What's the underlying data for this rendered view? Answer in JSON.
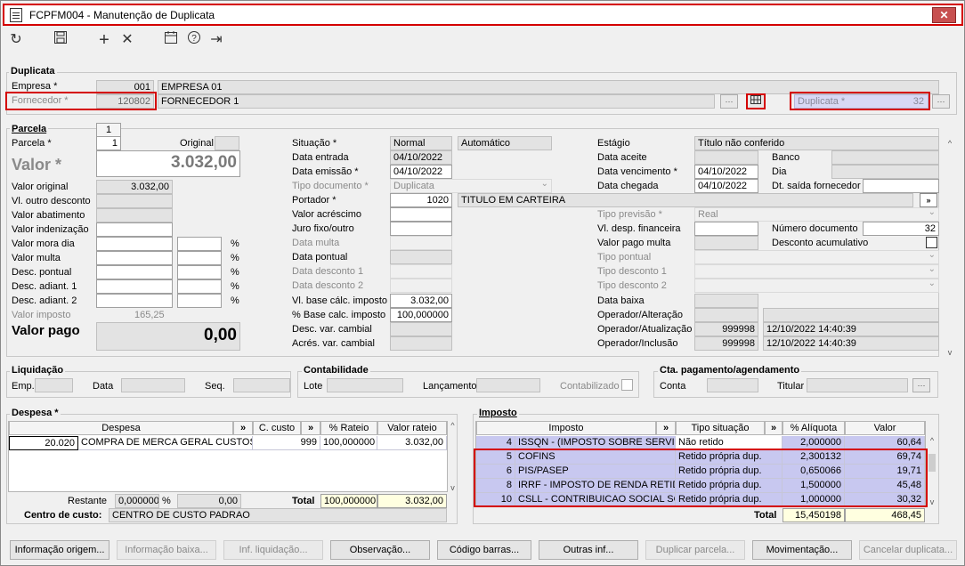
{
  "window": {
    "title": "FCPFM004 - Manutenção de Duplicata",
    "close": "✕"
  },
  "toolbar": {
    "refresh": "↻",
    "save": "💾",
    "add": "+",
    "delete": "✕",
    "calendar": "📅",
    "help": "?",
    "exit": "⇥"
  },
  "duplicata": {
    "group_title": "Duplicata",
    "empresa_label": "Empresa *",
    "empresa_code": "001",
    "empresa_name": "EMPRESA 01",
    "fornecedor_label": "Fornecedor *",
    "fornecedor_code": "120802",
    "fornecedor_name": "FORNECEDOR 1",
    "duplicata_label": "Duplicata *",
    "duplicata_value": "32"
  },
  "parcela": {
    "group_title": "Parcela",
    "tab": "1",
    "parcela_label": "Parcela *",
    "parcela_value": "1",
    "original_label": "Original",
    "valor_label": "Valor *",
    "valor_value": "3.032,00",
    "valor_original_label": "Valor original",
    "valor_original": "3.032,00",
    "outro_desconto_label": "Vl. outro desconto",
    "abatimento_label": "Valor abatimento",
    "indenizacao_label": "Valor indenização",
    "mora_label": "Valor mora dia",
    "multa_label": "Valor multa",
    "desc_pontual_label": "Desc. pontual",
    "desc_adiant1_label": "Desc. adiant. 1",
    "desc_adiant2_label": "Desc. adiant. 2",
    "valor_imposto_label": "Valor imposto",
    "valor_imposto": "165,25",
    "valor_pago_label": "Valor pago",
    "valor_pago": "0,00",
    "pct": "%",
    "situacao_label": "Situação *",
    "situacao": "Normal",
    "situacao2": "Automático",
    "data_entrada_label": "Data entrada",
    "data_entrada": "04/10/2022",
    "data_emissao_label": "Data emissão *",
    "data_emissao": "04/10/2022",
    "tipo_doc_label": "Tipo documento *",
    "tipo_doc": "Duplicata",
    "portador_label": "Portador *",
    "portador_code": "1020",
    "portador_name": "TITULO EM CARTEIRA",
    "acrescimo_label": "Valor acréscimo",
    "juro_label": "Juro fixo/outro",
    "data_multa_label": "Data multa",
    "data_pontual_label": "Data pontual",
    "data_desc1_label": "Data desconto 1",
    "data_desc2_label": "Data desconto 2",
    "base_calc_label": "Vl. base cálc. imposto",
    "base_calc": "3.032,00",
    "pct_base_label": "% Base calc. imposto",
    "pct_base": "100,000000",
    "desc_cambial_label": "Desc. var. cambial",
    "acres_cambial_label": "Acrés. var. cambial",
    "estagio_label": "Estágio",
    "estagio": "Título não conferido",
    "data_aceite_label": "Data aceite",
    "banco_label": "Banco",
    "data_venc_label": "Data vencimento *",
    "data_venc": "04/10/2022",
    "dia_label": "Dia",
    "data_chegada_label": "Data chegada",
    "data_chegada": "04/10/2022",
    "dt_saida_label": "Dt. saída fornecedor",
    "tipo_previsao_label": "Tipo previsão *",
    "tipo_previsao": "Real",
    "desp_fin_label": "Vl. desp. financeira",
    "num_doc_label": "Número documento",
    "num_doc": "32",
    "pago_multa_label": "Valor pago multa",
    "desc_acum_label": "Desconto acumulativo",
    "tipo_pontual_label": "Tipo pontual",
    "tipo_desc1_label": "Tipo desconto 1",
    "tipo_desc2_label": "Tipo desconto 2",
    "data_baixa_label": "Data baixa",
    "op_alt_label": "Operador/Alteração",
    "op_atu_label": "Operador/Atualização",
    "op_atu_code": "999998",
    "op_atu_date": "12/10/2022 14:40:39",
    "op_inc_label": "Operador/Inclusão",
    "op_inc_code": "999998",
    "op_inc_date": "12/10/2022 14:40:39"
  },
  "liquidacao": {
    "title": "Liquidação",
    "emp": "Emp.",
    "data": "Data",
    "seq": "Seq."
  },
  "contabilidade": {
    "title": "Contabilidade",
    "lote": "Lote",
    "lancamento": "Lançamento",
    "contabilizado": "Contabilizado"
  },
  "cta": {
    "title": "Cta. pagamento/agendamento",
    "conta": "Conta",
    "titular": "Titular"
  },
  "despesa": {
    "title": "Despesa *",
    "headers": [
      "Despesa",
      "»",
      "C. custo",
      "»",
      "% Rateio",
      "Valor rateio"
    ],
    "rows": [
      [
        "20.020",
        "COMPRA DE MERCA GERAL CUSTOS M",
        "999",
        "100,000000",
        "3.032,00"
      ]
    ],
    "restante_label": "Restante",
    "restante_pct": "0,000000",
    "restante_valor": "0,00",
    "pct": "%",
    "total_label": "Total",
    "total_pct": "100,000000",
    "total_valor": "3.032,00",
    "centro_label": "Centro de custo:",
    "centro_value": "CENTRO DE CUSTO PADRAO"
  },
  "imposto": {
    "title": "Imposto",
    "headers": [
      "Imposto",
      "»",
      "Tipo situação",
      "»",
      "% Alíquota",
      "Valor"
    ],
    "rows": [
      [
        "4",
        "ISSQN - (IMPOSTO SOBRE SERVICO",
        "Não retido",
        "2,000000",
        "60,64"
      ],
      [
        "5",
        "COFINS",
        "Retido própria dup.",
        "2,300132",
        "69,74"
      ],
      [
        "6",
        "PIS/PASEP",
        "Retido própria dup.",
        "0,650066",
        "19,71"
      ],
      [
        "8",
        "IRRF - IMPOSTO DE RENDA RETIDO N",
        "Retido própria dup.",
        "1,500000",
        "45,48"
      ],
      [
        "10",
        "CSLL - CONTRIBUICAO SOCIAL SOB",
        "Retido própria dup.",
        "1,000000",
        "30,32"
      ]
    ],
    "total_label": "Total",
    "total_pct": "15,450198",
    "total_valor": "468,45"
  },
  "buttons": [
    {
      "label": "Informação origem...",
      "enabled": true
    },
    {
      "label": "Informação baixa...",
      "enabled": false
    },
    {
      "label": "Inf. liquidação...",
      "enabled": false
    },
    {
      "label": "Observação...",
      "enabled": true
    },
    {
      "label": "Código barras...",
      "enabled": true
    },
    {
      "label": "Outras inf...",
      "enabled": true
    },
    {
      "label": "Duplicar parcela...",
      "enabled": false
    },
    {
      "label": "Movimentação...",
      "enabled": true
    },
    {
      "label": "Cancelar duplicata...",
      "enabled": false
    }
  ]
}
